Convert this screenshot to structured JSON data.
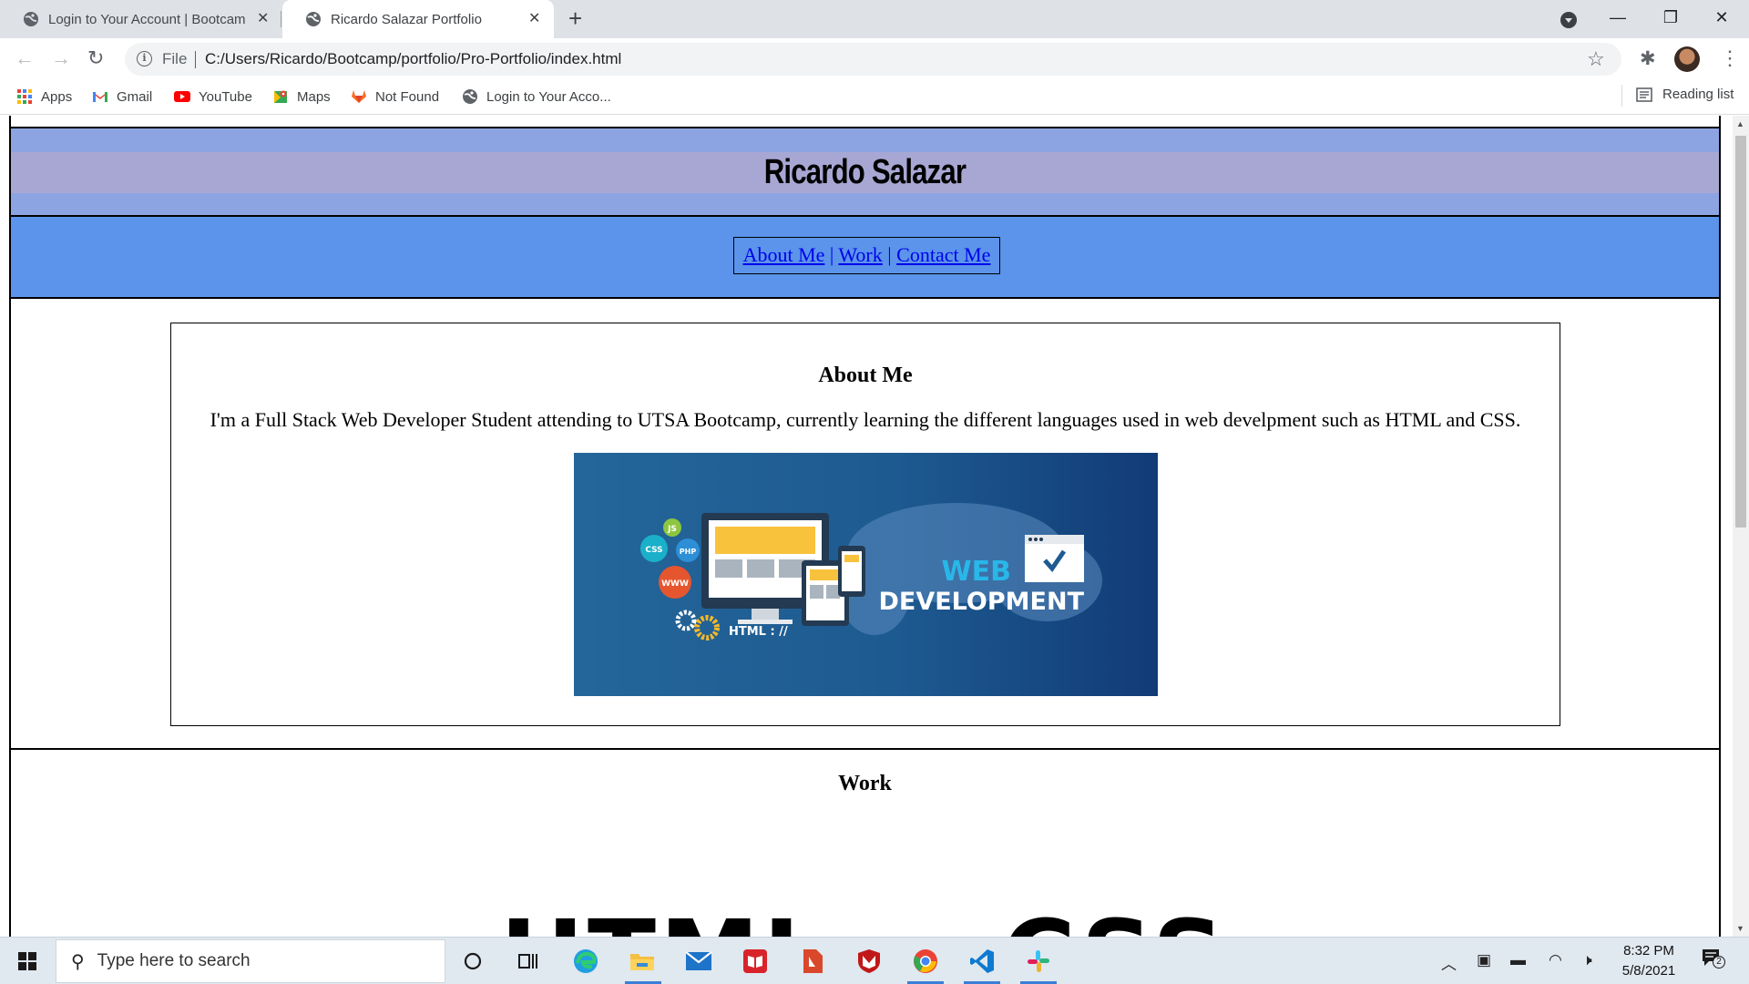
{
  "browser": {
    "tabs": [
      {
        "title": "Login to Your Account | Bootcam",
        "active": false
      },
      {
        "title": "Ricardo Salazar Portfolio",
        "active": true
      }
    ],
    "address": {
      "scheme_label": "File",
      "url": "C:/Users/Ricardo/Bootcamp/portfolio/Pro-Portfolio/index.html"
    },
    "bookmarks": [
      {
        "label": "Apps",
        "icon": "apps-grid-icon"
      },
      {
        "label": "Gmail",
        "icon": "gmail-icon"
      },
      {
        "label": "YouTube",
        "icon": "youtube-icon"
      },
      {
        "label": "Maps",
        "icon": "maps-icon"
      },
      {
        "label": "Not Found",
        "icon": "gitlab-icon"
      },
      {
        "label": "Login to Your Acco...",
        "icon": "globe-icon"
      }
    ],
    "reading_list": "Reading list"
  },
  "page": {
    "header": {
      "title": "Ricardo Salazar"
    },
    "nav": {
      "about": "About Me",
      "work": "Work",
      "contact": "Contact Me",
      "separator": "|"
    },
    "about": {
      "heading": "About Me",
      "text": "I'm a Full Stack Web Developer Student attending to UTSA Bootcamp, currently learning the different languages used in web develpment such as HTML and CSS.",
      "image": {
        "badges": [
          "JS",
          "CSS",
          "PHP",
          "WWW"
        ],
        "label_html": "HTML : //",
        "label_web": "WEB",
        "label_dev": "DEVELOPMENT"
      }
    },
    "work": {
      "heading": "Work",
      "big_left": "HTML",
      "big_right": "CSS"
    }
  },
  "taskbar": {
    "search_placeholder": "Type here to search",
    "time": "8:32 PM",
    "date": "5/8/2021",
    "notification_count": "2"
  },
  "colors": {
    "header_bg": "#8da4e3",
    "header_band": "#a8a7d4",
    "nav_bg": "#5b94ea",
    "link": "#0000ee"
  }
}
